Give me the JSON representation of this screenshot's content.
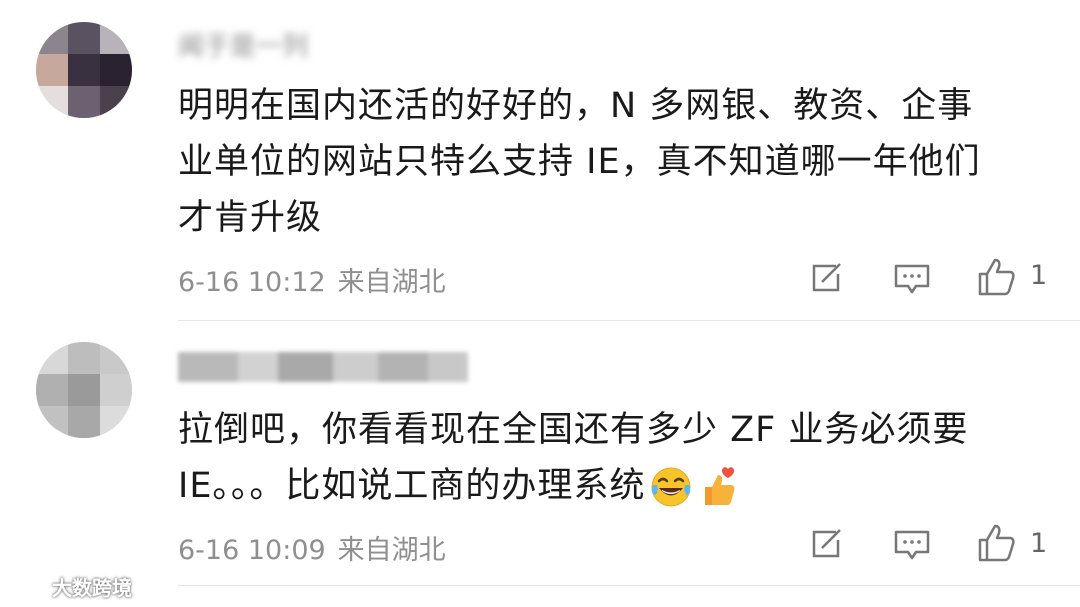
{
  "comments": [
    {
      "username": "闻于是一列",
      "text_lines": [
        "明明在国内还活的好好的，N 多网银、教资、企事",
        "业单位的网站只特么支持 IE，真不知道哪一年他们",
        "才肯升级"
      ],
      "timestamp": "6-16 10:12",
      "location": "来自湖北",
      "like_count": "1"
    },
    {
      "username": "",
      "text_lines": [
        "拉倒吧，你看看现在全国还有多少 ZF 业务必须要",
        "IE。。。比如说工商的办理系统"
      ],
      "emojis": [
        "laughing-crying-emoji",
        "thumbs-up-heart-emoji"
      ],
      "timestamp": "6-16 10:09",
      "location": "来自湖北",
      "like_count": "1"
    }
  ],
  "watermark": "大数跨境",
  "colors": {
    "meta_text": "#8f8f8f",
    "divider": "#e6e6e6",
    "icon_stroke": "#777777"
  }
}
